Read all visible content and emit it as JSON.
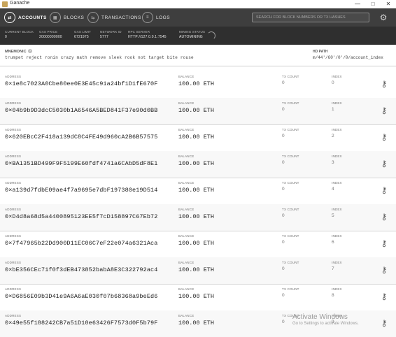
{
  "window": {
    "title": "Ganache",
    "controls": [
      "—",
      "□",
      "✕"
    ]
  },
  "nav": {
    "items": [
      {
        "label": "ACCOUNTS",
        "icon": "accounts-icon",
        "glyph": "⇄"
      },
      {
        "label": "BLOCKS",
        "icon": "blocks-icon",
        "glyph": "▦"
      },
      {
        "label": "TRANSACTIONS",
        "icon": "transactions-icon",
        "glyph": "⇆"
      },
      {
        "label": "LOGS",
        "icon": "logs-icon",
        "glyph": "≡"
      }
    ],
    "search_placeholder": "SEARCH FOR BLOCK NUMBERS OR TX HASHES",
    "settings_icon": "gear-icon"
  },
  "status": [
    {
      "label": "CURRENT BLOCK",
      "value": "0"
    },
    {
      "label": "GAS PRICE",
      "value": "20000000000"
    },
    {
      "label": "GAS LIMIT",
      "value": "6721975"
    },
    {
      "label": "NETWORK ID",
      "value": "5777"
    },
    {
      "label": "RPC SERVER",
      "value": "HTTP://127.0.0.1:7545"
    },
    {
      "label": "MINING STATUS",
      "value": "AUTOMINING"
    }
  ],
  "mnemonic": {
    "label": "MNEMONIC",
    "words": "trumpet reject ronin crazy math remove sleek rook not target bite rouse"
  },
  "hd_path": {
    "label": "HD PATH",
    "value": "m/44'/60'/0'/0/account_index"
  },
  "column_labels": {
    "address": "ADDRESS",
    "balance": "BALANCE",
    "tx_count": "TX COUNT",
    "index": "INDEX"
  },
  "accounts": [
    {
      "address": "0×1e8c7023A0Cbe80ee0E3E45c91a24bf1D1fE670F",
      "balance": "100.00 ETH",
      "tx_count": "0",
      "index": "0"
    },
    {
      "address": "0×04b9b9D3dcC5030b1A6546A5BED841F37e90d0BB",
      "balance": "100.00 ETH",
      "tx_count": "0",
      "index": "1"
    },
    {
      "address": "0×620EBcC2F418a139dC8C4FE49d960cA2B6B57575",
      "balance": "100.00 ETH",
      "tx_count": "0",
      "index": "2"
    },
    {
      "address": "0×BA1351BD499F9F5199E60fdf4741a6CAbD5dF8E1",
      "balance": "100.00 ETH",
      "tx_count": "0",
      "index": "3"
    },
    {
      "address": "0×a139d7fdbE09ae4f7a9695e7dbF197380e19D514",
      "balance": "100.00 ETH",
      "tx_count": "0",
      "index": "4"
    },
    {
      "address": "0×D4d8a68d5a4400895123EE5f7cD158897C67Eb72",
      "balance": "100.00 ETH",
      "tx_count": "0",
      "index": "5"
    },
    {
      "address": "0×7f47965b22Dd900D11EC06C7eF22e074a6321Aca",
      "balance": "100.00 ETH",
      "tx_count": "0",
      "index": "6"
    },
    {
      "address": "0×bE356CEc71f0f3dEB473852babA8E3C322792ac4",
      "balance": "100.00 ETH",
      "tx_count": "0",
      "index": "7"
    },
    {
      "address": "0×D6856E09b3D41e9A6A6aE030f07b68368a9beEd6",
      "balance": "100.00 ETH",
      "tx_count": "0",
      "index": "8"
    },
    {
      "address": "0×49e55f188242CB7a51D10e63426F7573d0F5b79F",
      "balance": "100.00 ETH",
      "tx_count": "0",
      "index": "9"
    }
  ],
  "key_icon": "key-icon",
  "watermark": {
    "line1": "Activate Windows",
    "line2": "Go to Settings to activate Windows."
  }
}
